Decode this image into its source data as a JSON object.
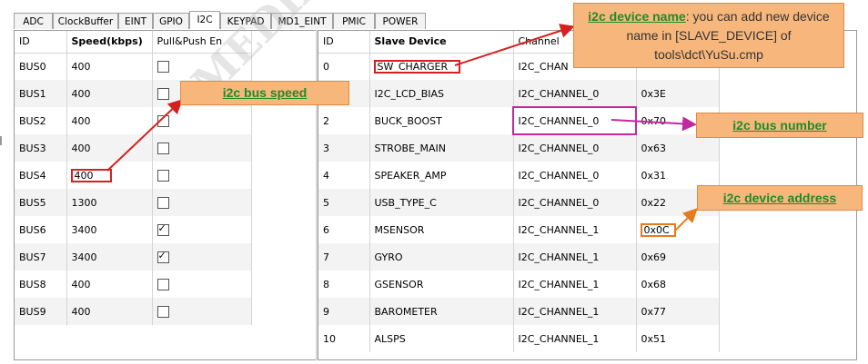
{
  "tabs": [
    {
      "label": "ADC",
      "active": false
    },
    {
      "label": "ClockBuffer",
      "active": false
    },
    {
      "label": "EINT",
      "active": false
    },
    {
      "label": "GPIO",
      "active": false
    },
    {
      "label": "I2C",
      "active": true
    },
    {
      "label": "KEYPAD",
      "active": false
    },
    {
      "label": "MD1_EINT",
      "active": false
    },
    {
      "label": "PMIC",
      "active": false
    },
    {
      "label": "POWER",
      "active": false
    }
  ],
  "bus_table": {
    "headers": {
      "id": "ID",
      "speed": "Speed(kbps)",
      "pull": "Pull&Push En"
    },
    "rows": [
      {
        "id": "BUS0",
        "speed": "400",
        "pull": false
      },
      {
        "id": "BUS1",
        "speed": "400",
        "pull": false
      },
      {
        "id": "BUS2",
        "speed": "400",
        "pull": false
      },
      {
        "id": "BUS3",
        "speed": "400",
        "pull": false
      },
      {
        "id": "BUS4",
        "speed": "400",
        "pull": false
      },
      {
        "id": "BUS5",
        "speed": "1300",
        "pull": false
      },
      {
        "id": "BUS6",
        "speed": "3400",
        "pull": true
      },
      {
        "id": "BUS7",
        "speed": "3400",
        "pull": true
      },
      {
        "id": "BUS8",
        "speed": "400",
        "pull": false
      },
      {
        "id": "BUS9",
        "speed": "400",
        "pull": false
      }
    ]
  },
  "device_table": {
    "headers": {
      "id": "ID",
      "device": "Slave Device",
      "channel": "Channel",
      "address": ""
    },
    "rows": [
      {
        "id": "0",
        "device": "SW_CHARGER",
        "channel": "I2C_CHAN",
        "address": ""
      },
      {
        "id": "",
        "device": "I2C_LCD_BIAS",
        "channel": "I2C_CHANNEL_0",
        "address": "0x3E"
      },
      {
        "id": "2",
        "device": "BUCK_BOOST",
        "channel": "I2C_CHANNEL_0",
        "address": "0x70"
      },
      {
        "id": "3",
        "device": "STROBE_MAIN",
        "channel": "I2C_CHANNEL_0",
        "address": "0x63"
      },
      {
        "id": "4",
        "device": "SPEAKER_AMP",
        "channel": "I2C_CHANNEL_0",
        "address": "0x31"
      },
      {
        "id": "5",
        "device": "USB_TYPE_C",
        "channel": "I2C_CHANNEL_0",
        "address": "0x22"
      },
      {
        "id": "6",
        "device": "MSENSOR",
        "channel": "I2C_CHANNEL_1",
        "address": "0x0C"
      },
      {
        "id": "7",
        "device": "GYRO",
        "channel": "I2C_CHANNEL_1",
        "address": "0x69"
      },
      {
        "id": "8",
        "device": "GSENSOR",
        "channel": "I2C_CHANNEL_1",
        "address": "0x68"
      },
      {
        "id": "9",
        "device": "BAROMETER",
        "channel": "I2C_CHANNEL_1",
        "address": "0x77"
      },
      {
        "id": "10",
        "device": "ALSPS",
        "channel": "I2C_CHANNEL_1",
        "address": "0x51"
      }
    ]
  },
  "callouts": {
    "device_name": {
      "key": "i2c device name",
      "text": ": you can add new device name in [SLAVE_DEVICE] of tools\\dct\\YuSu.cmp"
    },
    "bus_speed": {
      "key": "i2c bus speed"
    },
    "bus_number": {
      "key": "i2c bus number"
    },
    "device_address": {
      "key": "i2c device address"
    }
  },
  "watermark": "MEDIATEK CONFIDENTIAL · eastaeon.com",
  "colors": {
    "callout_fill": "#f7b77c",
    "callout_key": "#1f8b2a",
    "red": "#d42020",
    "magenta": "#c02aa0",
    "orange": "#e87a1e"
  }
}
